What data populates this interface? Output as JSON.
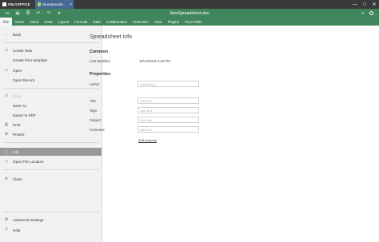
{
  "titlebar": {
    "brand": "ONLYOFFICE",
    "doc_tab": "NewSpreads...",
    "doc_tab_close": "×",
    "win": {
      "minimize": "—",
      "maximize": "□",
      "close": "✕"
    }
  },
  "header": {
    "title": "NewSpreadsheet.xlsx",
    "quick": {
      "open": "▭",
      "save": "▤",
      "print": "⎙",
      "undo": "↶",
      "redo": "↷",
      "more": "▾"
    },
    "right": {
      "location": "⌂"
    }
  },
  "tabs": [
    "File",
    "Home",
    "Insert",
    "Draw",
    "Layout",
    "Formula",
    "Data",
    "Collaboration",
    "Protection",
    "View",
    "Plugins",
    "Pivot Table"
  ],
  "sidebar": {
    "back": "Back",
    "create_new": "Create New",
    "create_template": "Create from template",
    "open": "Open",
    "open_recent": "Open Recent",
    "save": "Save",
    "save_as": "Save As",
    "export_pdf": "Export to PDF",
    "print": "Print",
    "protect": "Protect",
    "info": "Info",
    "open_location": "Open File Location",
    "close": "Close",
    "advanced": "Advanced Settings",
    "help": "Help",
    "icons": {
      "back": "←",
      "new": "▭",
      "open": "▱",
      "save": "▤",
      "print": "⎙",
      "protect": "⊘",
      "info": "ⓘ",
      "folder": "▱",
      "close": "✕",
      "settings": "⚙",
      "help": "?"
    }
  },
  "info": {
    "title": "Spreadsheet info",
    "common": "Common",
    "last_modified_label": "Last Modified",
    "last_modified_value": "10/14/2014 3:40 PM",
    "properties": "Properties",
    "author_label": "Author",
    "author_placeholder": "Add Author",
    "title_label": "Title",
    "tags_label": "Tags",
    "subject_label": "Subject",
    "comment_label": "Comment",
    "text_placeholder": "Add Text",
    "add_property": "Add property"
  },
  "colors": {
    "brand": "#40865c",
    "tab_blue": "#446995",
    "titlebar": "#3a3a3a",
    "active_item": "#999999"
  }
}
